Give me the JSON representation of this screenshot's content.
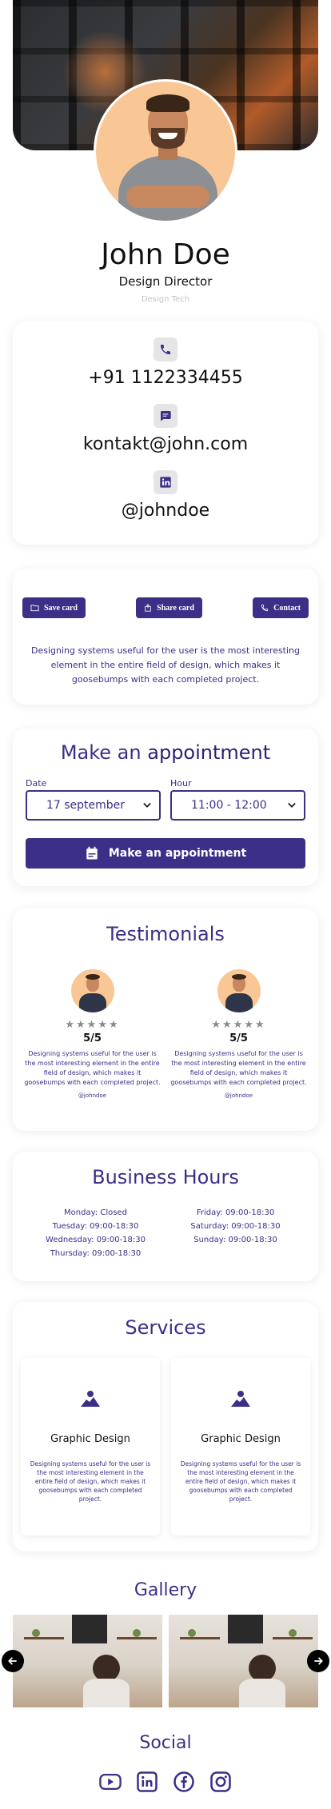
{
  "profile": {
    "name": "John Doe",
    "role": "Design Director",
    "company": "Design Tech"
  },
  "contact": {
    "phone": "+91 1122334455",
    "email": "kontakt@john.com",
    "linkedin": "@johndoe"
  },
  "actions": {
    "save_label": "Save card",
    "share_label": "Share card",
    "contact_label": "Contact",
    "about": "Designing systems useful for the user is the most interesting element in the entire field of design, which makes it goosebumps with each completed project."
  },
  "appointment": {
    "title_plain": "Make an",
    "title_bold": "appointment",
    "date_label": "Date",
    "date_value": "17 september",
    "hour_label": "Hour",
    "hour_value": "11:00 - 12:00",
    "button_label": "Make an appointment"
  },
  "testimonials": {
    "title": "Testimonials",
    "items": [
      {
        "rating": "5/5",
        "text": "Designing systems useful for the user is the most interesting element in the entire field of design, which makes it goosebumps with each completed project.",
        "handle": "@johndoe"
      },
      {
        "rating": "5/5",
        "text": "Designing systems useful for the user is the most interesting element in the entire field of design, which makes it goosebumps with each completed project.",
        "handle": "@johndoe"
      }
    ]
  },
  "hours": {
    "title": "Business Hours",
    "left": [
      "Monday: Closed",
      "Tuesday: 09:00-18:30",
      "Wednesday: 09:00-18:30",
      "Thursday: 09:00-18:30"
    ],
    "right": [
      "Friday: 09:00-18:30",
      "Saturday: 09:00-18:30",
      "Sunday: 09:00-18:30"
    ]
  },
  "services": {
    "title": "Services",
    "items": [
      {
        "name": "Graphic Design",
        "text": "Designing systems useful for the user is the most interesting element in the entire field of design, which makes it goosebumps with each completed project."
      },
      {
        "name": "Graphic Design",
        "text": "Designing systems useful for the user is the most interesting element in the entire field of design, which makes it goosebumps with each completed project."
      }
    ]
  },
  "gallery": {
    "title": "Gallery"
  },
  "social": {
    "title": "Social",
    "icons": [
      "youtube-icon",
      "linkedin-icon",
      "facebook-icon",
      "instagram-icon"
    ]
  },
  "colors": {
    "accent": "#3b2f87",
    "avatar_bg": "#f9c796",
    "icon_bg": "#e5e5e5"
  }
}
